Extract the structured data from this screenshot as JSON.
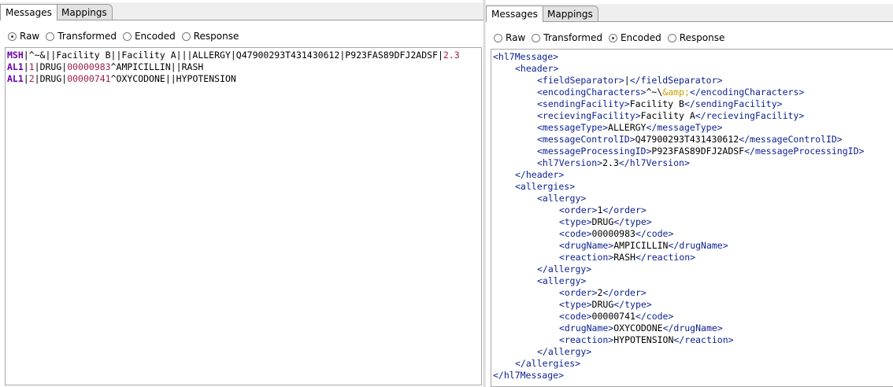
{
  "left_panel": {
    "tabs": [
      "Messages",
      "Mappings"
    ],
    "radios": [
      {
        "label": "Raw",
        "selected": true
      },
      {
        "label": "Transformed",
        "selected": false
      },
      {
        "label": "Encoded",
        "selected": false
      },
      {
        "label": "Response",
        "selected": false
      }
    ],
    "raw_lines": [
      {
        "segment": "MSH",
        "parts": [
          {
            "t": "|^~&||Facility B||Facility A|||ALLERGY|Q47900293T431430612|P923FAS89DFJ2ADSF|",
            "c": "txt"
          },
          {
            "t": "2.3",
            "c": "num"
          }
        ]
      },
      {
        "segment": "AL1",
        "parts": [
          {
            "t": "|",
            "c": "txt"
          },
          {
            "t": "1",
            "c": "num"
          },
          {
            "t": "|DRUG|",
            "c": "txt"
          },
          {
            "t": "00000983",
            "c": "num"
          },
          {
            "t": "^AMPICILLIN||RASH",
            "c": "txt"
          }
        ]
      },
      {
        "segment": "AL1",
        "parts": [
          {
            "t": "|",
            "c": "txt"
          },
          {
            "t": "2",
            "c": "num"
          },
          {
            "t": "|DRUG|",
            "c": "txt"
          },
          {
            "t": "00000741",
            "c": "num"
          },
          {
            "t": "^OXYCODONE||HYPOTENSION",
            "c": "txt"
          }
        ]
      }
    ]
  },
  "right_panel": {
    "tabs": [
      "Messages",
      "Mappings"
    ],
    "radios": [
      {
        "label": "Raw",
        "selected": false
      },
      {
        "label": "Transformed",
        "selected": false
      },
      {
        "label": "Encoded",
        "selected": true
      },
      {
        "label": "Response",
        "selected": false
      }
    ],
    "xml_lines": [
      {
        "indent": 0,
        "open": "hl7Message"
      },
      {
        "indent": 1,
        "open": "header"
      },
      {
        "indent": 2,
        "tag": "fieldSeparator",
        "value": "|"
      },
      {
        "indent": 2,
        "tag": "encodingCharacters",
        "value": "^~\\",
        "entity": "&amp;"
      },
      {
        "indent": 2,
        "tag": "sendingFacility",
        "value": "Facility B"
      },
      {
        "indent": 2,
        "tag": "recievingFacility",
        "value": "Facility A"
      },
      {
        "indent": 2,
        "tag": "messageType",
        "value": "ALLERGY"
      },
      {
        "indent": 2,
        "tag": "messageControlID",
        "value": "Q47900293T431430612"
      },
      {
        "indent": 2,
        "tag": "messageProcessingID",
        "value": "P923FAS89DFJ2ADSF"
      },
      {
        "indent": 2,
        "tag": "hl7Version",
        "value": "2.3"
      },
      {
        "indent": 1,
        "close": "header"
      },
      {
        "indent": 1,
        "open": "allergies"
      },
      {
        "indent": 2,
        "open": "allergy"
      },
      {
        "indent": 3,
        "tag": "order",
        "value": "1"
      },
      {
        "indent": 3,
        "tag": "type",
        "value": "DRUG"
      },
      {
        "indent": 3,
        "tag": "code",
        "value": "00000983"
      },
      {
        "indent": 3,
        "tag": "drugName",
        "value": "AMPICILLIN"
      },
      {
        "indent": 3,
        "tag": "reaction",
        "value": "RASH"
      },
      {
        "indent": 2,
        "close": "allergy"
      },
      {
        "indent": 2,
        "open": "allergy"
      },
      {
        "indent": 3,
        "tag": "order",
        "value": "2"
      },
      {
        "indent": 3,
        "tag": "type",
        "value": "DRUG"
      },
      {
        "indent": 3,
        "tag": "code",
        "value": "00000741"
      },
      {
        "indent": 3,
        "tag": "drugName",
        "value": "OXYCODONE"
      },
      {
        "indent": 3,
        "tag": "reaction",
        "value": "HYPOTENSION"
      },
      {
        "indent": 2,
        "close": "allergy"
      },
      {
        "indent": 1,
        "close": "allergies"
      },
      {
        "indent": 0,
        "close": "hl7Message"
      }
    ]
  }
}
